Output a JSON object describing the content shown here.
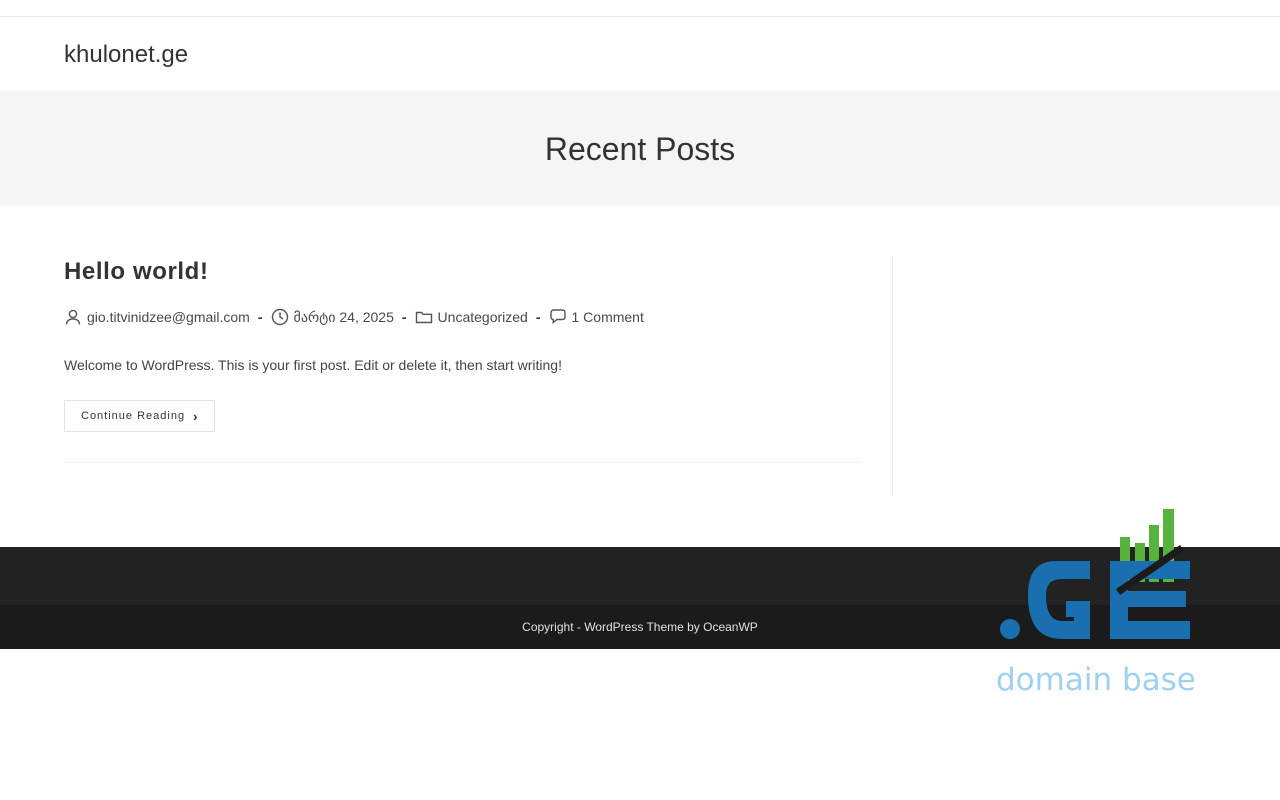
{
  "header": {
    "site_title": "khulonet.ge"
  },
  "page_header": {
    "title": "Recent Posts"
  },
  "post": {
    "title": "Hello world!",
    "author": "gio.titvinidzee@gmail.com",
    "date": "მარტი 24, 2025",
    "category": "Uncategorized",
    "comments": "1 Comment",
    "excerpt": "Welcome to WordPress. This is your first post. Edit or delete it, then start writing!",
    "continue_label": "Continue Reading"
  },
  "footer": {
    "copyright": "Copyright - WordPress Theme by OceanWP"
  },
  "logo": {
    "mark_text": ".GE",
    "sub_text": "domain base",
    "colors": {
      "blue": "#1a6fb0",
      "green": "#58b33e",
      "light_blue": "#9fd1ee"
    }
  },
  "icons": {
    "author": "user-icon",
    "date": "clock-icon",
    "category": "folder-icon",
    "comments": "comment-icon",
    "continue": "chevron-right-icon"
  }
}
